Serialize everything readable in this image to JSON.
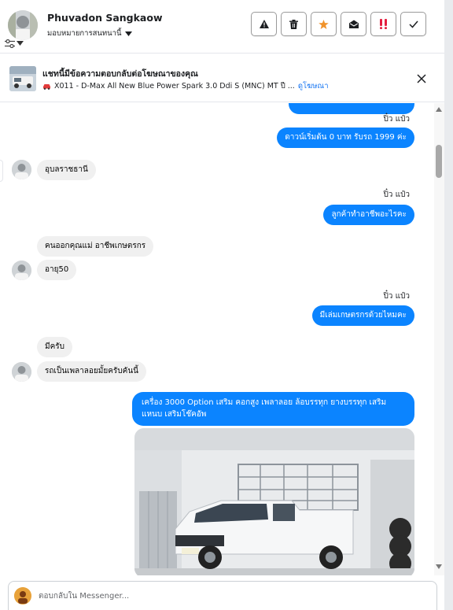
{
  "header": {
    "contact_name": "Phuvadon Sangkaow",
    "assign_label": "มอบหมายการสนทนานี้",
    "actions": [
      {
        "name": "report-button",
        "icon": "warning-icon"
      },
      {
        "name": "delete-button",
        "icon": "trash-icon"
      },
      {
        "name": "star-button",
        "icon": "star-icon"
      },
      {
        "name": "mark-unread-button",
        "icon": "envelope-open-icon"
      },
      {
        "name": "spam-button",
        "icon": "exclamation-icon"
      },
      {
        "name": "mark-done-button",
        "icon": "check-icon"
      }
    ],
    "accent_star": "#f0932b",
    "accent_spam": "#e41e3f"
  },
  "ad_banner": {
    "title": "แชทนี้มีข้อความตอบกลับต่อโฆษณาของคุณ",
    "subtitle": "X011 - D-Max All New Blue Power Spark 3.0 Ddi S (MNC) MT ปี ...",
    "link_label": "ดูโฆษณา"
  },
  "messages": {
    "sender_tag_1": "ปิ๋ว แป๋ว",
    "out_1": "ดาวน์เริ่มต้น 0 บาท รับรถ 1999 ค่ะ",
    "in_1": "อุบลราชธานี",
    "sender_tag_2": "ปิ๋ว แป๋ว",
    "out_2": "ลูกค้าทำอาชีพอะไรคะ",
    "in_2a": "คนออกคุณแม่ อาชีพเกษตรกร",
    "in_2b": "อายุ50",
    "sender_tag_3": "ปิ๋ว แป๋ว",
    "out_3": "มีเล่มเกษตรกรด้วยไหมคะ",
    "in_3a": "มีครับ",
    "in_3b": "รถเป็นเพลาลอยมั้ยครับคันนี้",
    "out_4": "เครื่อง 3000 Option เสริม คอกสูง เพลาลอย ล้อบรรทุก ยางบรรทุก เสริมแหนบ เสริมโช๊คอัพ"
  },
  "composer": {
    "placeholder": "ตอบกลับใน Messenger..."
  },
  "colors": {
    "outgoing_bubble": "#0b84ff",
    "incoming_bubble": "#f0f0f0",
    "link": "#1876f2"
  }
}
